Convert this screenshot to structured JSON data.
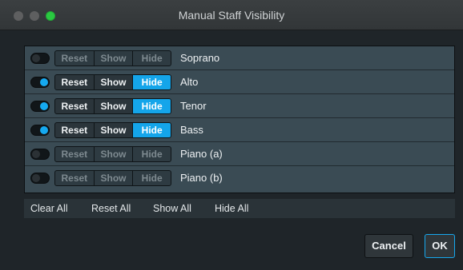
{
  "window": {
    "title": "Manual Staff Visibility"
  },
  "colors": {
    "accent": "#14a5ea",
    "panel": "#3a4b54",
    "background": "#1f2529"
  },
  "staves": [
    {
      "name": "Soprano",
      "enabled": false,
      "reset_label": "Reset",
      "show_label": "Show",
      "hide_label": "Hide",
      "selected": ""
    },
    {
      "name": "Alto",
      "enabled": true,
      "reset_label": "Reset",
      "show_label": "Show",
      "hide_label": "Hide",
      "selected": "Hide"
    },
    {
      "name": "Tenor",
      "enabled": true,
      "reset_label": "Reset",
      "show_label": "Show",
      "hide_label": "Hide",
      "selected": "Hide"
    },
    {
      "name": "Bass",
      "enabled": true,
      "reset_label": "Reset",
      "show_label": "Show",
      "hide_label": "Hide",
      "selected": "Hide"
    },
    {
      "name": "Piano (a)",
      "enabled": false,
      "reset_label": "Reset",
      "show_label": "Show",
      "hide_label": "Hide",
      "selected": ""
    },
    {
      "name": "Piano (b)",
      "enabled": false,
      "reset_label": "Reset",
      "show_label": "Show",
      "hide_label": "Hide",
      "selected": ""
    }
  ],
  "actions": {
    "clear_all": "Clear All",
    "reset_all": "Reset All",
    "show_all": "Show All",
    "hide_all": "Hide All"
  },
  "buttons": {
    "cancel": "Cancel",
    "ok": "OK"
  }
}
